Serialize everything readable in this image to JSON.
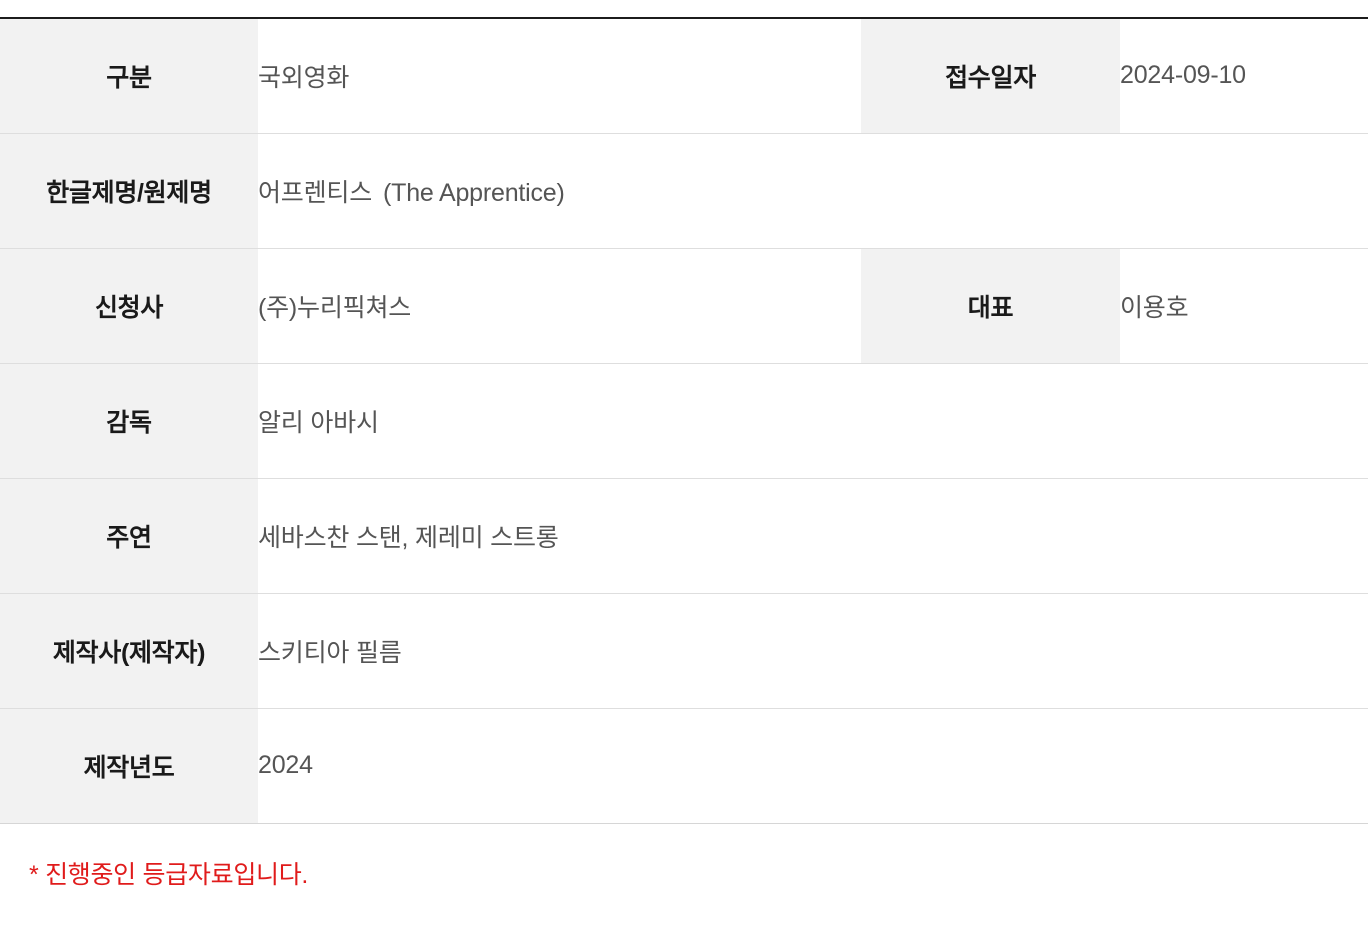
{
  "table": {
    "rows": [
      {
        "label": "구분",
        "value": "국외영화",
        "label2": "접수일자",
        "value2": "2024-09-10"
      },
      {
        "label": "한글제명/원제명",
        "value_kr": "어프렌티스",
        "value_orig": "(The Apprentice)"
      },
      {
        "label": "신청사",
        "value": "(주)누리픽쳐스",
        "label2": "대표",
        "value2": "이용호"
      },
      {
        "label": "감독",
        "value": "알리 아바시"
      },
      {
        "label": "주연",
        "value": "세바스찬 스탠, 제레미 스트롱"
      },
      {
        "label": "제작사(제작자)",
        "value": "스키티아 필름"
      },
      {
        "label": "제작년도",
        "value": "2024"
      }
    ]
  },
  "footnote": {
    "text": "* 진행중인 등급자료입니다."
  },
  "colors": {
    "label_background": "#F2F2F2",
    "value_background": "#FFFFFF",
    "label_text": "#1A1A1A",
    "value_text": "#555555",
    "top_border": "#1C1C1C",
    "row_divider": "#DEDEDE",
    "footnote_text": "#E01B1B"
  }
}
